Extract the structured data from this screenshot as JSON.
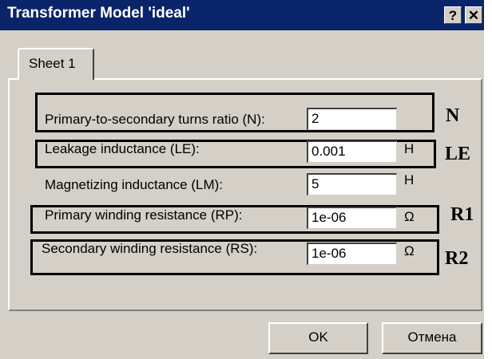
{
  "window": {
    "title": "Transformer Model 'ideal'",
    "help_glyph": "?",
    "close_glyph": "✕"
  },
  "tab": {
    "label": "Sheet 1"
  },
  "fields": [
    {
      "label": "Primary-to-secondary turns ratio (N):",
      "value": "2",
      "unit": "",
      "annotation": "N"
    },
    {
      "label": "Leakage inductance (LE):",
      "value": "0.001",
      "unit": "H",
      "annotation": "LE"
    },
    {
      "label": "Magnetizing inductance (LM):",
      "value": "5",
      "unit": "H",
      "annotation": ""
    },
    {
      "label": "Primary winding resistance (RP):",
      "value": "1e-06",
      "unit": "Ω",
      "annotation": "R1"
    },
    {
      "label": "Secondary winding resistance (RS):",
      "value": "1e-06",
      "unit": "Ω",
      "annotation": "R2"
    }
  ],
  "buttons": {
    "ok": "OK",
    "cancel": "Отмена"
  },
  "colors": {
    "titlebar": "#0a246a",
    "face": "#d4d0c8"
  }
}
